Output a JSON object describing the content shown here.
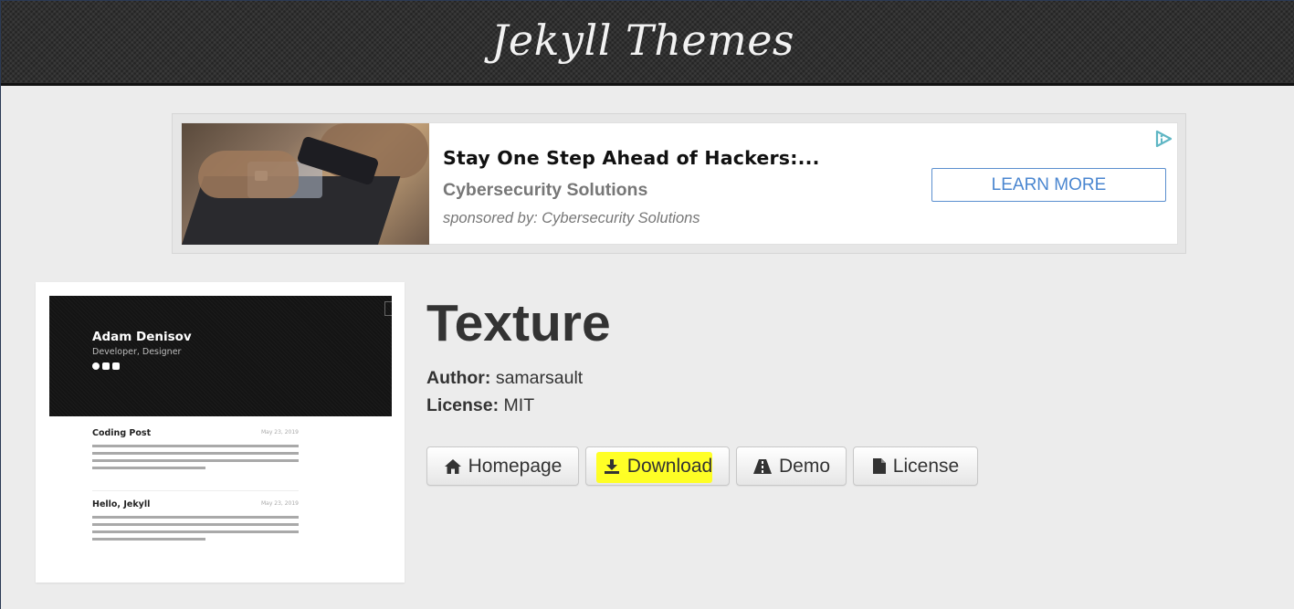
{
  "header": {
    "site_title": "Jekyll Themes"
  },
  "ad": {
    "headline": "Stay One Step Ahead of Hackers:...",
    "subtitle": "Cybersecurity Solutions",
    "sponsor": "sponsored by: Cybersecurity Solutions",
    "cta_label": "LEARN MORE",
    "choices_icon": "ad-choices-icon",
    "accent_color": "#4a86d0"
  },
  "preview": {
    "name": "Adam Denisov",
    "role": "Developer, Designer",
    "posts": [
      {
        "title": "Coding Post",
        "date": "May 23, 2019"
      },
      {
        "title": "Hello, Jekyll",
        "date": "May 23, 2019"
      }
    ]
  },
  "theme": {
    "title": "Texture",
    "author_label": "Author:",
    "author": "samarsault",
    "license_label": "License:",
    "license": "MIT"
  },
  "buttons": {
    "homepage": {
      "label": "Homepage",
      "icon": "home-icon"
    },
    "download": {
      "label": "Download",
      "icon": "download-icon",
      "highlight_color": "#ffff1a"
    },
    "demo": {
      "label": "Demo",
      "icon": "road-icon"
    },
    "license": {
      "label": "License",
      "icon": "file-icon"
    }
  }
}
